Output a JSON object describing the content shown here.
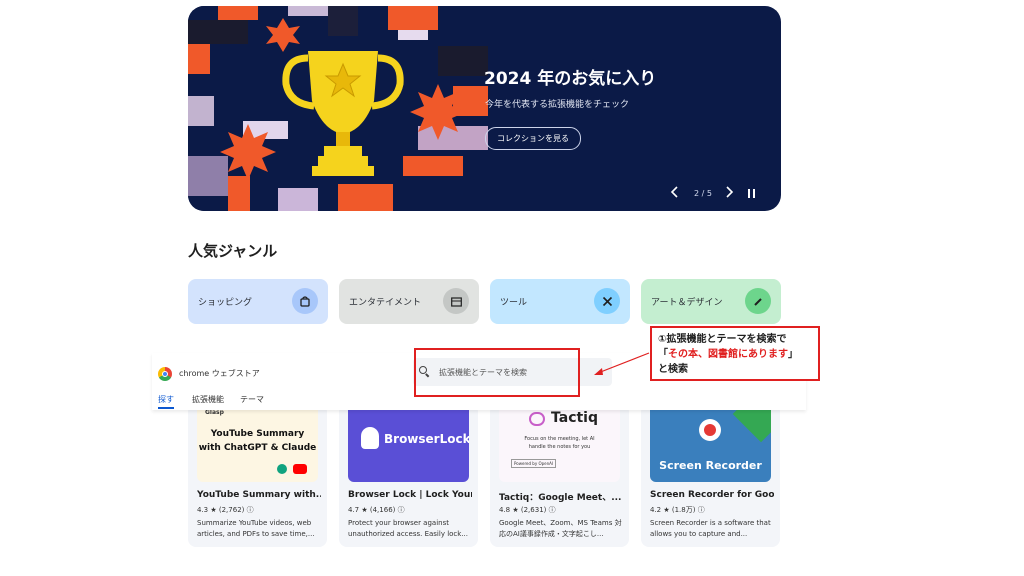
{
  "hero": {
    "title": "2024 年のお気に入り",
    "subtitle": "今年を代表する拡張機能をチェック",
    "button": "コレクションを見る",
    "page_indicator": "2 / 5",
    "prev_icon": "chevron-left-icon",
    "next_icon": "chevron-right-icon",
    "pause_icon": "pause-icon"
  },
  "genres": {
    "title": "人気ジャンル",
    "items": [
      {
        "label": "ショッピング",
        "icon": "shopping-bag-icon",
        "bg": "#d3e3fd",
        "icon_bg": "#a8c7fa"
      },
      {
        "label": "エンタテイメント",
        "icon": "calendar-icon",
        "bg": "#e1e3e1",
        "icon_bg": "#c4c7c5"
      },
      {
        "label": "ツール",
        "icon": "tools-icon",
        "bg": "#c2e7ff",
        "icon_bg": "#7fcfff"
      },
      {
        "label": "アート＆デザイン",
        "icon": "brush-icon",
        "bg": "#c4eed0",
        "icon_bg": "#6dd58c"
      }
    ]
  },
  "store": {
    "name": "chrome ウェブストア",
    "search_placeholder": "拡張機能とテーマを検索",
    "tabs": [
      {
        "label": "探す"
      },
      {
        "label": "拡張機能"
      },
      {
        "label": "テーマ"
      }
    ]
  },
  "annotation": {
    "line1": "①拡張機能とテーマを検索で",
    "line2_open": "「",
    "line2_highlight": "その本、図書館にあります",
    "line2_close": "」",
    "line3": "と検索"
  },
  "cards": [
    {
      "thumb_brand": "Glasp",
      "thumb_line1": "YouTube Summary",
      "thumb_line2": "with ChatGPT & Claude",
      "title": "YouTube Summary with...",
      "rating": "4.3",
      "count": "(2,762)",
      "desc": "Summarize YouTube videos, web articles, and PDFs to save time,..."
    },
    {
      "thumb_text": "BrowserLock",
      "title": "Browser Lock | Lock Your...",
      "rating": "4.7",
      "count": "(4,166)",
      "desc": "Protect your browser against unauthorized access. Easily lock..."
    },
    {
      "thumb_title": "Tactiq",
      "thumb_line1": "Focus on the meeting, let AI",
      "thumb_line2": "handle the notes for you",
      "thumb_badge": "Powered by OpenAI",
      "title": "Tactiq：Google Meet、...",
      "rating": "4.8",
      "count": "(2,631)",
      "desc": "Google Meet、Zoom、MS Teams 対応のAI議事録作成・文字起こし..."
    },
    {
      "thumb_text": "Screen Recorder",
      "title": "Screen Recorder for Googl...",
      "rating": "4.2",
      "count": "(1.8万)",
      "desc": "Screen Recorder is a software that allows you to capture and..."
    }
  ],
  "colors": {
    "hero_bg": "#0b1a47",
    "accent": "#0b57d0",
    "annotation_red": "#e02020"
  }
}
